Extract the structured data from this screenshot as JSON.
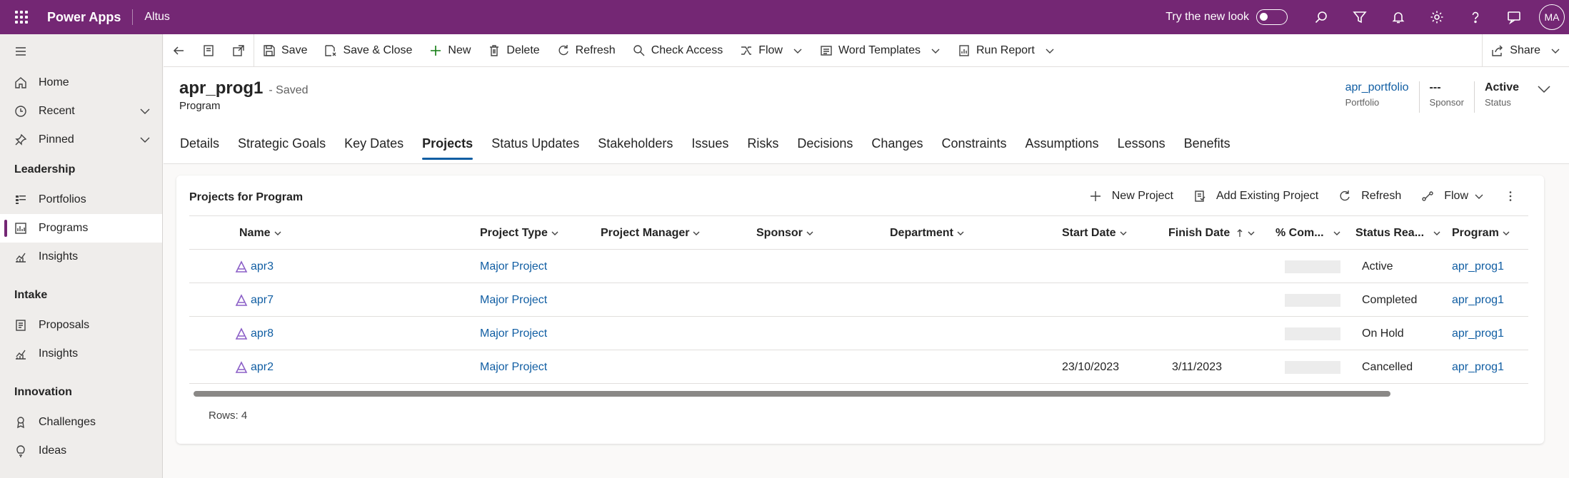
{
  "topbar": {
    "app_title": "Power Apps",
    "app_name": "Altus",
    "try_new_look": "Try the new look",
    "avatar": "MA",
    "icons": [
      "search-icon",
      "filter-icon",
      "bell-icon",
      "gear-icon",
      "help-icon",
      "chat-icon"
    ]
  },
  "sidebar": {
    "top_items": [
      {
        "label": "Home",
        "icon": "home-icon"
      },
      {
        "label": "Recent",
        "icon": "clock-icon"
      },
      {
        "label": "Pinned",
        "icon": "pin-icon"
      }
    ],
    "sections": [
      {
        "title": "Leadership",
        "items": [
          {
            "label": "Portfolios",
            "icon": "portfolio-icon"
          },
          {
            "label": "Programs",
            "icon": "program-icon",
            "active": true
          },
          {
            "label": "Insights",
            "icon": "chart-icon"
          }
        ]
      },
      {
        "title": "Intake",
        "items": [
          {
            "label": "Proposals",
            "icon": "document-icon"
          },
          {
            "label": "Insights",
            "icon": "chart-icon"
          }
        ]
      },
      {
        "title": "Innovation",
        "items": [
          {
            "label": "Challenges",
            "icon": "trophy-icon"
          },
          {
            "label": "Ideas",
            "icon": "lightbulb-icon"
          }
        ]
      }
    ]
  },
  "commandbar": {
    "save": "Save",
    "save_close": "Save & Close",
    "new": "New",
    "delete": "Delete",
    "refresh": "Refresh",
    "check_access": "Check Access",
    "flow": "Flow",
    "word_templates": "Word Templates",
    "run_report": "Run Report",
    "share": "Share"
  },
  "record": {
    "title": "apr_prog1",
    "saved_status": "- Saved",
    "entity": "Program",
    "fields": [
      {
        "value": "apr_portfolio",
        "label": "Portfolio",
        "link": true
      },
      {
        "value": "---",
        "label": "Sponsor",
        "link": false
      },
      {
        "value": "Active",
        "label": "Status",
        "link": false
      }
    ]
  },
  "tabs": [
    "Details",
    "Strategic Goals",
    "Key Dates",
    "Projects",
    "Status Updates",
    "Stakeholders",
    "Issues",
    "Risks",
    "Decisions",
    "Changes",
    "Constraints",
    "Assumptions",
    "Lessons",
    "Benefits"
  ],
  "active_tab": "Projects",
  "subgrid": {
    "title": "Projects for Program",
    "commands": {
      "new_project": "New Project",
      "add_existing": "Add Existing Project",
      "refresh": "Refresh",
      "flow": "Flow"
    },
    "columns": [
      "Name",
      "Project Type",
      "Project Manager",
      "Sponsor",
      "Department",
      "Start Date",
      "Finish Date",
      "% Com...",
      "Status Rea...",
      "Program"
    ],
    "rows": [
      {
        "name": "apr3",
        "type": "Major Project",
        "manager": "",
        "sponsor": "",
        "department": "",
        "start": "",
        "finish": "",
        "status": "Active",
        "program": "apr_prog1"
      },
      {
        "name": "apr7",
        "type": "Major Project",
        "manager": "",
        "sponsor": "",
        "department": "",
        "start": "",
        "finish": "",
        "status": "Completed",
        "program": "apr_prog1"
      },
      {
        "name": "apr8",
        "type": "Major Project",
        "manager": "",
        "sponsor": "",
        "department": "",
        "start": "",
        "finish": "",
        "status": "On Hold",
        "program": "apr_prog1"
      },
      {
        "name": "apr2",
        "type": "Major Project",
        "manager": "",
        "sponsor": "",
        "department": "",
        "start": "23/10/2023",
        "finish": "3/11/2023",
        "status": "Cancelled",
        "program": "apr_prog1"
      }
    ],
    "rows_count": "Rows: 4"
  },
  "colors": {
    "brand": "#742774",
    "link": "#115ea3",
    "project_icon": "#8b5fc7"
  }
}
